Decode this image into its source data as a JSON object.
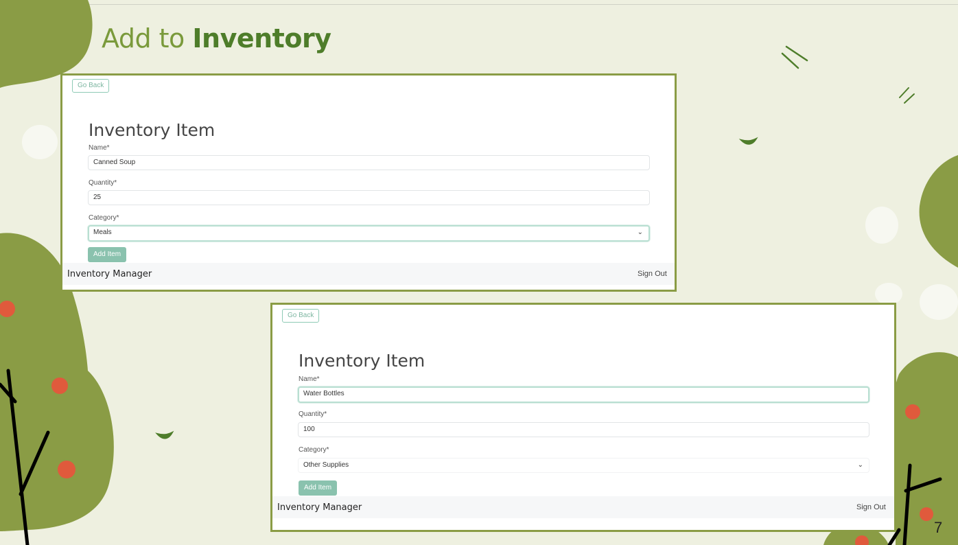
{
  "slide": {
    "title_prefix": "Add to ",
    "title_bold": "Inventory",
    "page_number": "7"
  },
  "colors": {
    "background": "#eef0e0",
    "accent_green": "#4e7d2a",
    "bush_green": "#8a9c45",
    "berry_red": "#e05a3c",
    "frame_border": "#8a9c45",
    "button_teal": "#8ac2ae"
  },
  "screenshots": [
    {
      "go_back": "Go Back",
      "form_title": "Inventory Item",
      "name_label": "Name*",
      "name_value": "Canned Soup",
      "quantity_label": "Quantity*",
      "quantity_value": "25",
      "category_label": "Category*",
      "category_value": "Meals",
      "add_item": "Add Item",
      "brand": "Inventory Manager",
      "sign_out": "Sign Out"
    },
    {
      "go_back": "Go Back",
      "form_title": "Inventory Item",
      "name_label": "Name*",
      "name_value": "Water Bottles",
      "quantity_label": "Quantity*",
      "quantity_value": "100",
      "category_label": "Category*",
      "category_value": "Other Supplies",
      "add_item": "Add Item",
      "brand": "Inventory Manager",
      "sign_out": "Sign Out"
    }
  ]
}
